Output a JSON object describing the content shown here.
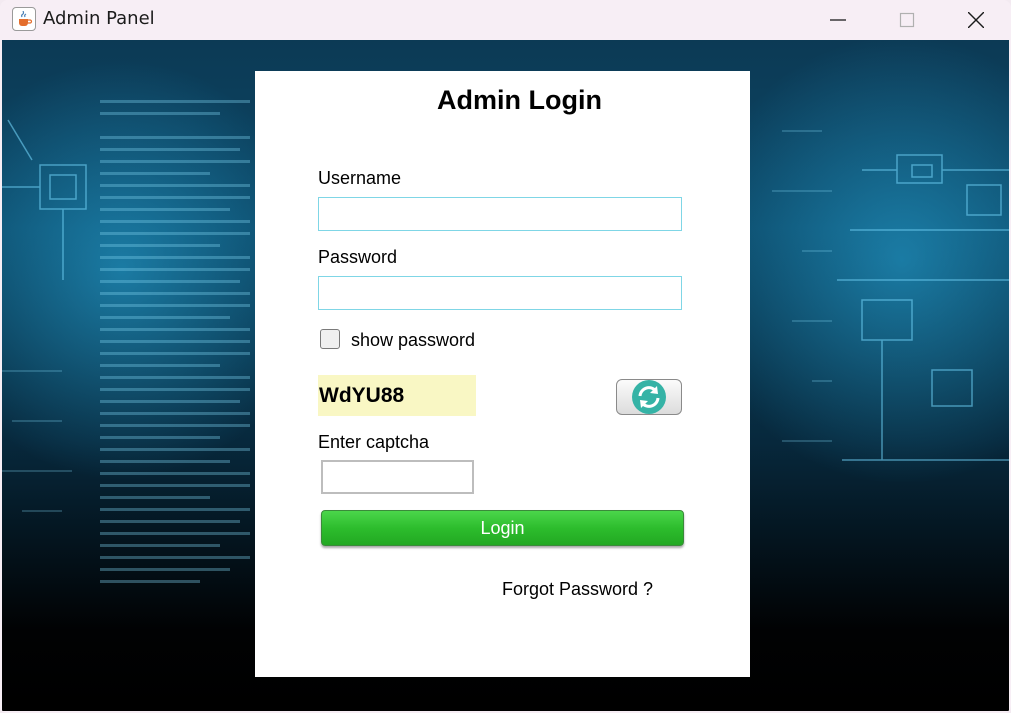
{
  "window": {
    "title": "Admin Panel",
    "icon": "java-cup-icon"
  },
  "form": {
    "heading": "Admin Login",
    "username_label": "Username",
    "username_value": "",
    "password_label": "Password",
    "password_value": "",
    "show_password_label": "show password",
    "show_password_checked": false,
    "captcha_text": "WdYU88",
    "refresh_icon": "refresh-icon",
    "captcha_label": "Enter captcha",
    "captcha_value": "",
    "login_label": "Login",
    "forgot_label": "Forgot Password ?"
  },
  "colors": {
    "login_button": "#2dbd2d",
    "captcha_background": "#f9f7c4",
    "refresh_icon": "#35b3a6",
    "field_border": "#7fd6e6",
    "background_glow": "#28aadc"
  }
}
